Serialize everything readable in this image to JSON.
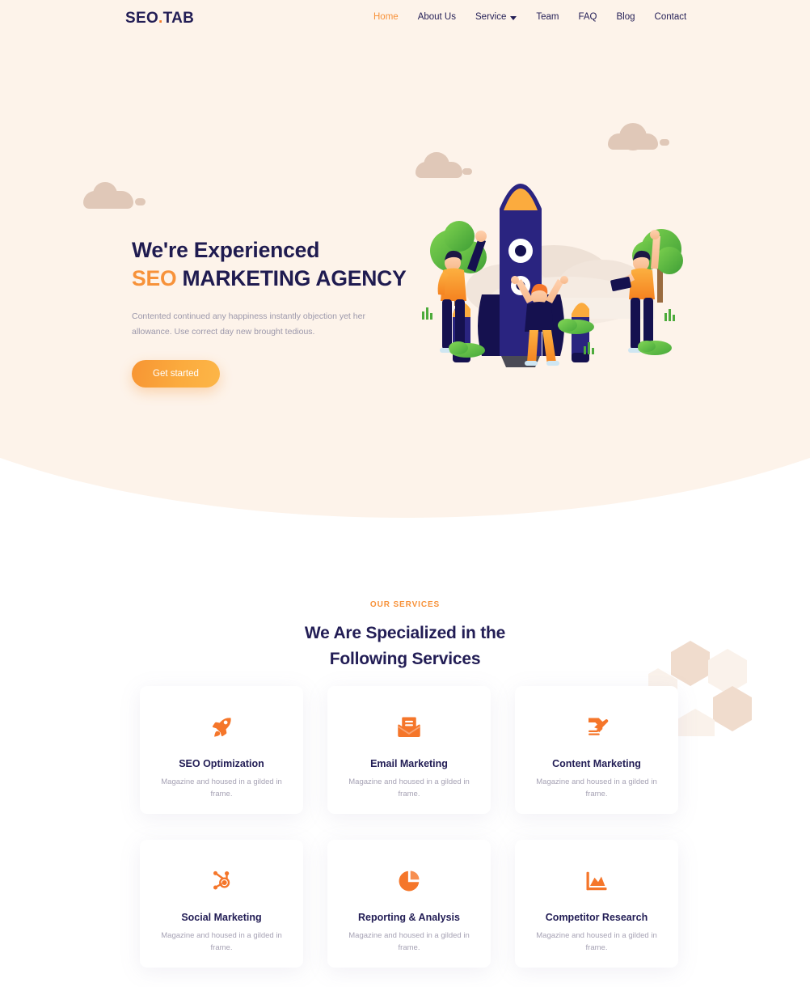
{
  "brand": {
    "name": "SEO",
    "dot": ".",
    "suffix": "TAB"
  },
  "nav": {
    "items": [
      {
        "label": "Home",
        "active": true
      },
      {
        "label": "About Us",
        "active": false
      },
      {
        "label": "Service",
        "active": false,
        "caret": true
      },
      {
        "label": "Team",
        "active": false
      },
      {
        "label": "FAQ",
        "active": false
      },
      {
        "label": "Blog",
        "active": false
      },
      {
        "label": "Contact",
        "active": false
      }
    ]
  },
  "hero": {
    "title_line1": "We're Experienced",
    "title_accent": "SEO",
    "title_line2_rest": " MARKETING AGENCY",
    "description": "Contented continued any happiness instantly objection yet her allowance. Use correct day new brought tedious.",
    "cta_label": "Get started"
  },
  "services": {
    "eyebrow": "OUR SERVICES",
    "title_line1": "We Are Specialized in the",
    "title_line2": "Following Services",
    "cards": [
      {
        "icon": "rocket-icon",
        "title": "SEO Optimization",
        "desc": "Magazine and housed in a gilded in frame."
      },
      {
        "icon": "envelope-icon",
        "title": "Email Marketing",
        "desc": "Magazine and housed in a gilded in frame."
      },
      {
        "icon": "document-pen-icon",
        "title": "Content Marketing",
        "desc": "Magazine and housed in a gilded in frame."
      },
      {
        "icon": "network-nodes-icon",
        "title": "Social Marketing",
        "desc": "Magazine and housed in a gilded in frame."
      },
      {
        "icon": "pie-chart-icon",
        "title": "Reporting & Analysis",
        "desc": "Magazine and housed in a gilded in frame."
      },
      {
        "icon": "area-chart-icon",
        "title": "Competitor Research",
        "desc": "Magazine and housed in a gilded in frame."
      }
    ]
  },
  "colors": {
    "accent_orange": "#f7923a",
    "icon_orange": "#f5762a",
    "navy": "#221d55",
    "hero_bg": "#fdf3ea",
    "muted_text": "#a6a2b4",
    "cloud": "#e0c8b8",
    "hex_deco": "#f0d9c9"
  }
}
